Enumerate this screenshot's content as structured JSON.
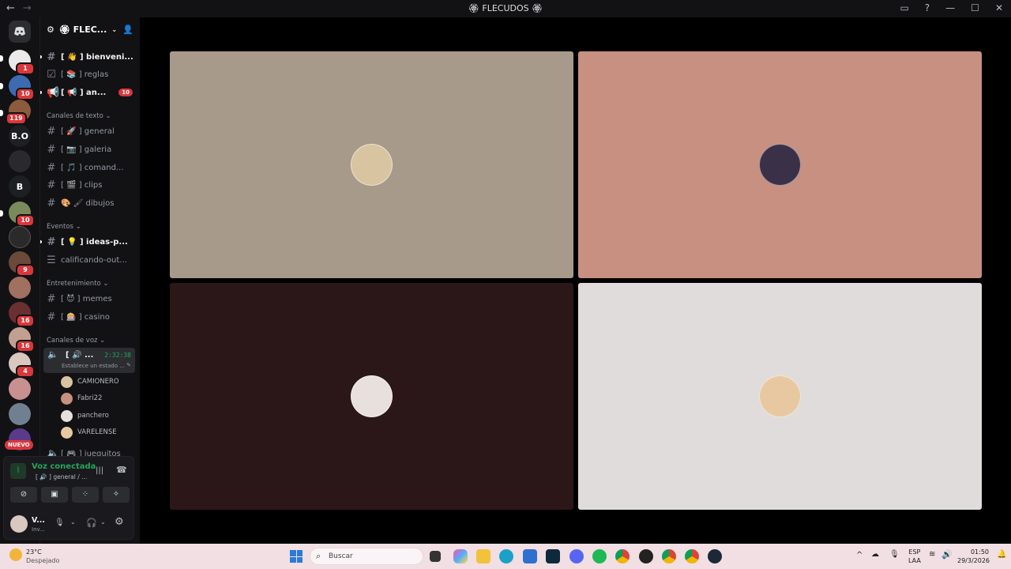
{
  "window": {
    "title": "🏵 FLECUDOS 🏵",
    "back_icon": "←",
    "forward_icon": "→"
  },
  "guilds": {
    "badges": [
      "1",
      "10",
      "119",
      "10",
      "9",
      "16",
      "16",
      "4"
    ],
    "text_labels": [
      "B.O",
      "B"
    ],
    "nuevo": "NUEVO"
  },
  "server": {
    "name": "🏵 FLEC...",
    "channels_top": [
      {
        "label": "[ 👋 ] bienveni...",
        "bold": true
      },
      {
        "label": "[ 📚 ] reglas",
        "bold": false
      },
      {
        "label": "[ 📢 ] an...",
        "bold": true,
        "badge": "10"
      }
    ],
    "categories": {
      "text": "Canales de texto",
      "events": "Eventos",
      "entertainment": "Entretenimiento",
      "voice": "Canales de voz"
    },
    "text_channels": [
      "[ 🚀 ] general",
      "[ 📷 ] galeria",
      "[ 🎵 ] comand...",
      "[ 🎬 ] clips",
      "🎨 🖌 dibujos"
    ],
    "event_channels": [
      "[ 💡 ] ideas-p...",
      "calificando-out..."
    ],
    "ent_channels": [
      "[ 😈 ] memes",
      "[ 🎰 ] casino"
    ],
    "voice_channel": {
      "label": "[ 🔊 ...",
      "timer": "2:32:38",
      "status": "Establece un estado ..."
    },
    "members": [
      "CAMIONERO",
      "Fabri22",
      "panchero",
      "VARELENSE"
    ],
    "next_voice": "[ 🎮 ] jueguitos"
  },
  "voice_panel": {
    "connected": "Voz conectada",
    "channel_path": "[ 🔊 ] general / ...",
    "user_name": "V...",
    "user_status": "Inv..."
  },
  "tiles": [
    {
      "bg": "#a89a8a",
      "avatar": "#d8c4a0"
    },
    {
      "bg": "#c89080",
      "avatar": "#3a3048"
    },
    {
      "bg": "#2b1618",
      "avatar": "#e8e0dc"
    },
    {
      "bg": "#e0dcdc",
      "avatar": "#e8c8a0"
    }
  ],
  "taskbar": {
    "weather_temp": "23°C",
    "weather_desc": "Despejado",
    "search_placeholder": "Buscar",
    "lang_top": "ESP",
    "lang_bottom": "LAA",
    "time": "01:50",
    "date": "29/3/2026"
  },
  "colors": {
    "accent_green": "#23a55a",
    "badge_red": "#da373c"
  }
}
